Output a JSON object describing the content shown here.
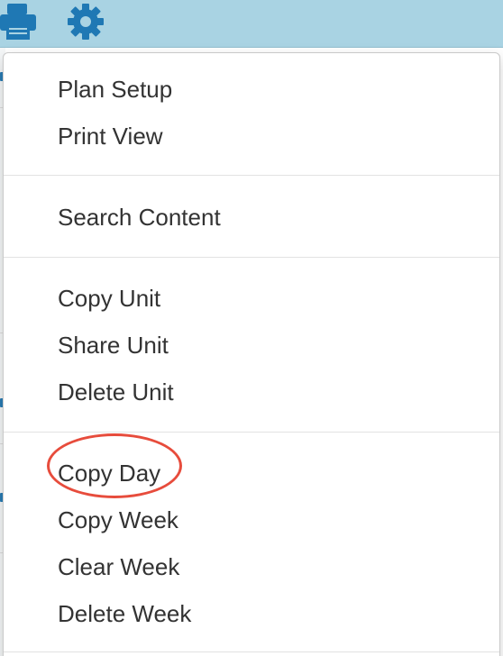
{
  "toolbar": {
    "icons": [
      "printer-icon",
      "gear-icon"
    ],
    "accent_color": "#a9d3e3",
    "icon_color": "#1f78b4"
  },
  "menu": {
    "groups": [
      {
        "items": [
          {
            "label": "Plan Setup"
          },
          {
            "label": "Print View"
          }
        ]
      },
      {
        "items": [
          {
            "label": "Search Content"
          }
        ]
      },
      {
        "items": [
          {
            "label": "Copy Unit"
          },
          {
            "label": "Share Unit"
          },
          {
            "label": "Delete Unit"
          }
        ]
      },
      {
        "items": [
          {
            "label": "Copy Day",
            "highlighted": true
          },
          {
            "label": "Copy Week"
          },
          {
            "label": "Clear Week"
          },
          {
            "label": "Delete Week"
          }
        ]
      }
    ],
    "highlight_color": "#e74c3c"
  }
}
